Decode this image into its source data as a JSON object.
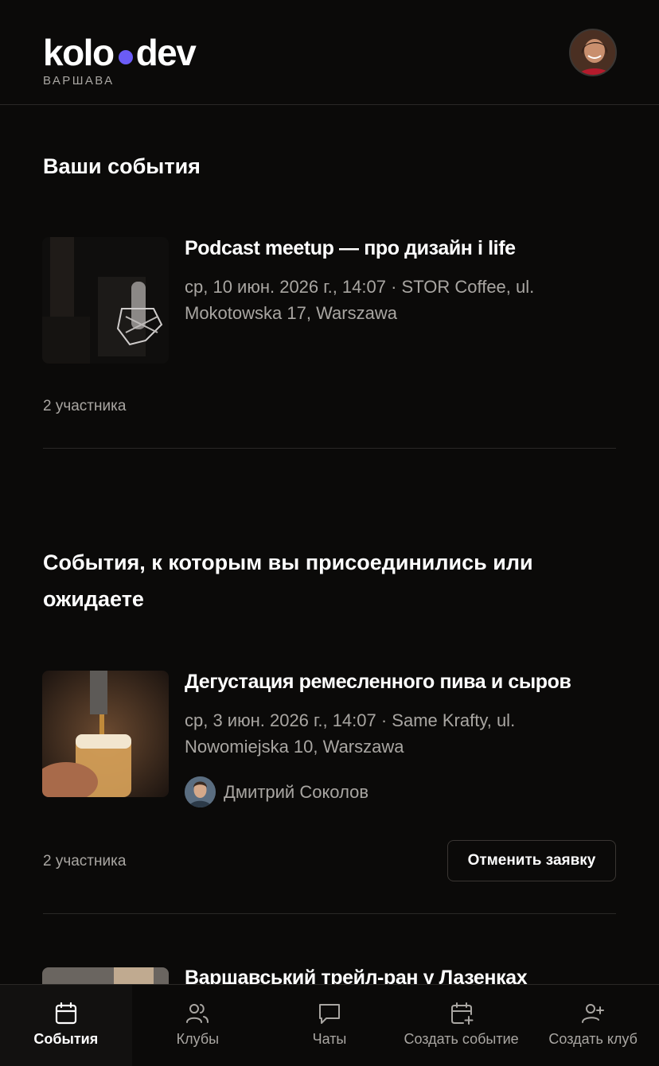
{
  "colors": {
    "accent": "#6b5cf6",
    "background": "#0b0a09",
    "muted": "#a9a6a2",
    "divider": "#2a2826"
  },
  "header": {
    "logo_left": "kolo",
    "logo_right": "dev",
    "city": "ВАРШАВА",
    "avatar_icon": "user-avatar"
  },
  "sections": {
    "your_events": "Ваши события",
    "joined_events": "События, к которым вы присоединились или ожидаете"
  },
  "events": [
    {
      "title": "Podcast meetup — про дизайн і life",
      "meta": "ср, 10 июн. 2026 г., 14:07 · STOR Coffee, ul. Mokotowska 17, Warszawa",
      "participants": "2 участника",
      "image_icon": "microphone-image"
    },
    {
      "title": "Дегустация ремесленного пива и сыров",
      "meta": "ср, 3 июн. 2026 г., 14:07 · Same Krafty, ul. Nowomiejska 10, Warszawa",
      "organizer": "Дмитрий Соколов",
      "participants": "2 участника",
      "cancel_label": "Отменить заявку",
      "image_icon": "beer-tap-image"
    },
    {
      "title": "Варшавський трейл-ран у Лазенках"
    }
  ],
  "nav": [
    {
      "label": "События",
      "icon": "calendar-icon",
      "active": true
    },
    {
      "label": "Клубы",
      "icon": "users-icon",
      "active": false
    },
    {
      "label": "Чаты",
      "icon": "chat-icon",
      "active": false
    },
    {
      "label": "Создать событие",
      "icon": "calendar-plus-icon",
      "active": false
    },
    {
      "label": "Создать клуб",
      "icon": "user-plus-icon",
      "active": false
    }
  ]
}
